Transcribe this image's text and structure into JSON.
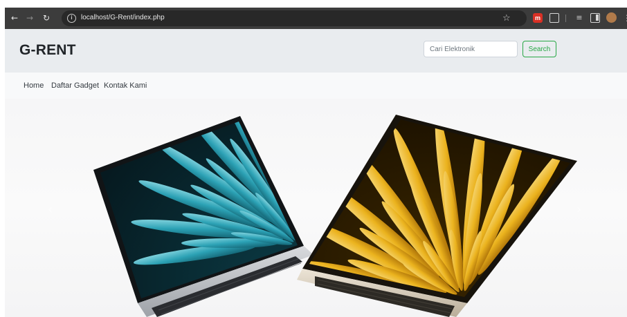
{
  "browser": {
    "back_icon": "arrow-left-icon",
    "forward_icon": "arrow-right-icon",
    "reload_icon": "reload-icon",
    "back_glyph": "←",
    "forward_glyph": "→",
    "reload_glyph": "↻",
    "site_info_glyph": "i",
    "url": "localhost/G-Rent/index.php",
    "bookmark_glyph": "☆",
    "extension_badge": "m",
    "queue_glyph": "≡",
    "menu_glyph": "⋮"
  },
  "header": {
    "brand": "G-RENT",
    "search_placeholder": "Cari Elektronik",
    "search_button": "Search"
  },
  "nav": {
    "items": [
      {
        "label": "Home"
      },
      {
        "label": "Daftar Gadget"
      },
      {
        "label": "Kontak Kami"
      }
    ]
  },
  "hero": {
    "image_subject": "Two laptops with teal and gold fan wallpapers",
    "prev_glyph": "‹",
    "next_glyph": "›"
  },
  "colors": {
    "accent_green": "#28a745",
    "header_bg": "#e9ecef",
    "browser_bar": "#3c3c3c",
    "teal_wallpaper": "#3fb4c6",
    "gold_wallpaper": "#f2b81f"
  }
}
